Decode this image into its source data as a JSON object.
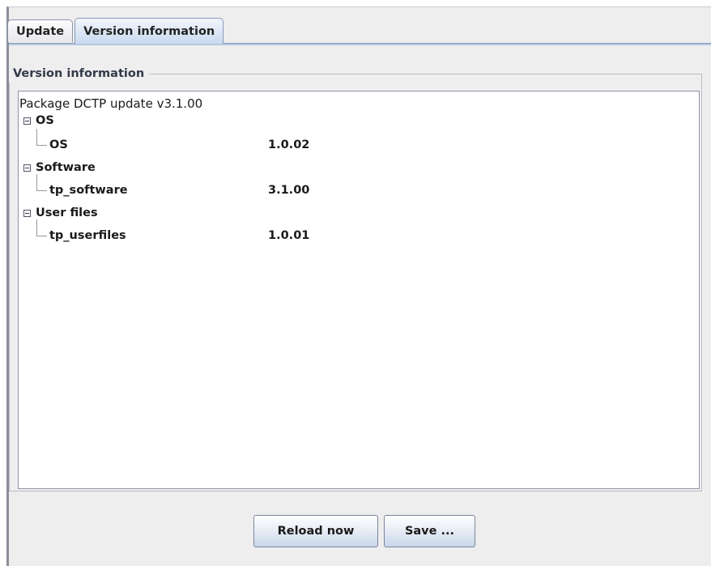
{
  "tabs": [
    {
      "label": "Update",
      "active": false
    },
    {
      "label": "Version information",
      "active": true
    }
  ],
  "group": {
    "title": "Version information"
  },
  "tree": {
    "root_label": "Package DCTP update v3.1.00",
    "nodes": [
      {
        "label": "OS",
        "expanded": true,
        "child": {
          "label": "OS",
          "version": "1.0.02"
        }
      },
      {
        "label": "Software",
        "expanded": true,
        "child": {
          "label": "tp_software",
          "version": "3.1.00"
        }
      },
      {
        "label": "User files",
        "expanded": true,
        "child": {
          "label": "tp_userfiles",
          "version": "1.0.01"
        }
      }
    ]
  },
  "buttons": {
    "reload_label": "Reload now",
    "save_label": "Save ..."
  },
  "colors": {
    "active_tab": "#c9d9f0",
    "window_bg": "#eeeeee"
  },
  "icons": {
    "expander": "tree-collapse-minus-icon"
  }
}
